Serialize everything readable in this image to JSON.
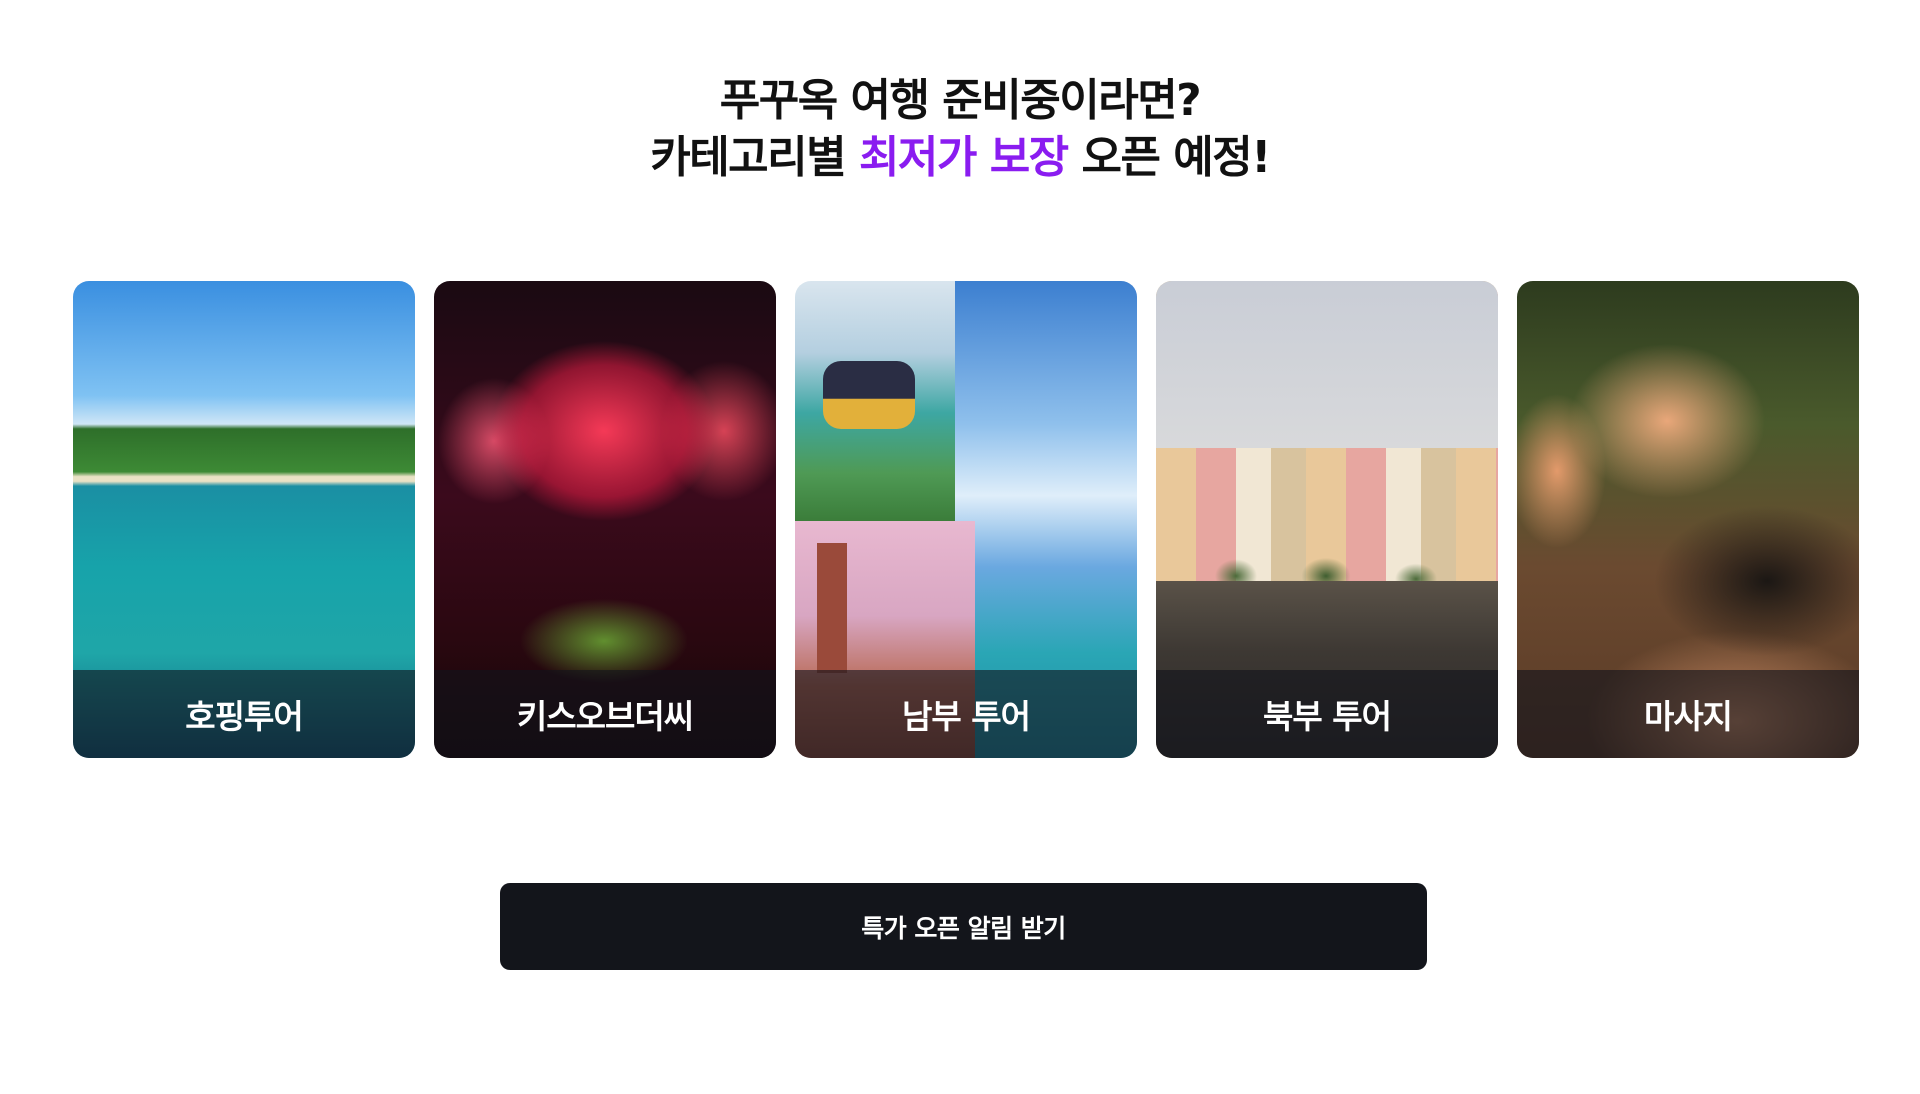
{
  "headline": {
    "line1": "푸꾸옥 여행 준비중이라면?",
    "line2_prefix": "카테고리별 ",
    "line2_accent": "최저가 보장",
    "line2_suffix": " 오픈 예정!"
  },
  "colors": {
    "accent": "#8a1cf0",
    "cta_background": "#13151b",
    "caption_overlay": "rgba(18,20,28,0.62)"
  },
  "categories": [
    {
      "label": "호핑투어",
      "image": "island-lagoon-photo"
    },
    {
      "label": "키스오브더씨",
      "image": "fireworks-show-photo"
    },
    {
      "label": "남부 투어",
      "image": "cable-car-collage-photo"
    },
    {
      "label": "북부 투어",
      "image": "colorful-buildings-photo"
    },
    {
      "label": "마사지",
      "image": "hot-stone-massage-photo"
    }
  ],
  "cta": {
    "label": "특가 오픈 알림 받기"
  }
}
